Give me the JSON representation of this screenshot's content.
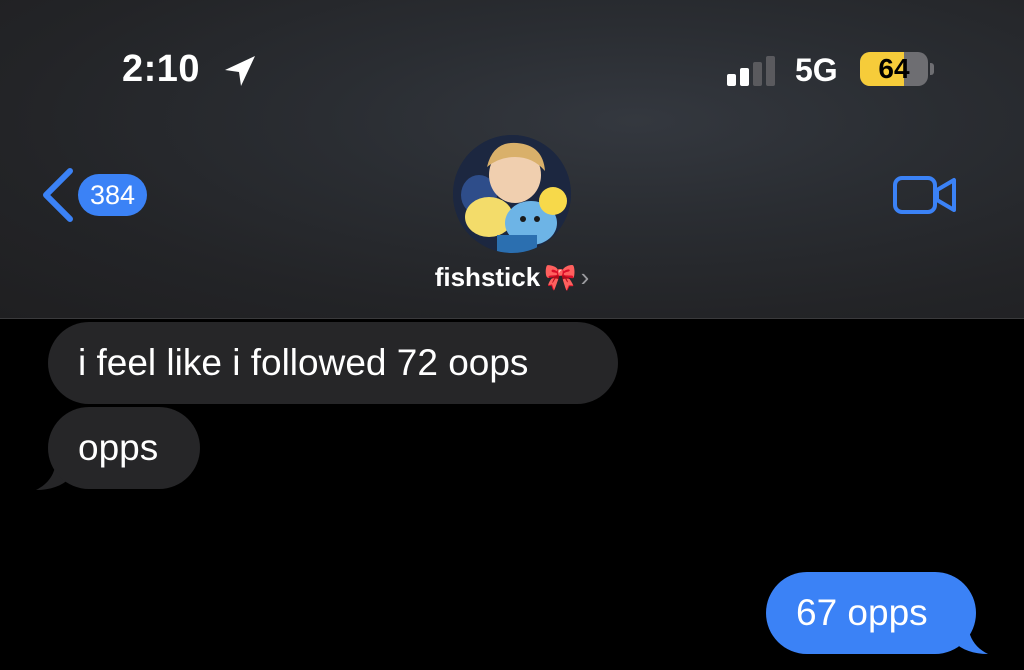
{
  "status_bar": {
    "time": "2:10",
    "location_icon": "location-arrow-icon",
    "signal_bars_active": 2,
    "signal_bars_total": 4,
    "network": "5G",
    "battery_percent": 64,
    "battery_text": "64",
    "battery_color": "#f6cc3a"
  },
  "header": {
    "back_icon": "chevron-left-icon",
    "unread_count": "384",
    "contact_name": "fishstick",
    "contact_emoji": "🎀",
    "video_icon": "video-camera-icon"
  },
  "messages": [
    {
      "direction": "received",
      "text": "i feel like i followed 72 oops"
    },
    {
      "direction": "received",
      "text": "opps"
    },
    {
      "direction": "sent",
      "text": "67 opps"
    }
  ],
  "colors": {
    "accent_blue": "#3b82f6",
    "received_bubble": "#262628",
    "background": "#000000"
  }
}
